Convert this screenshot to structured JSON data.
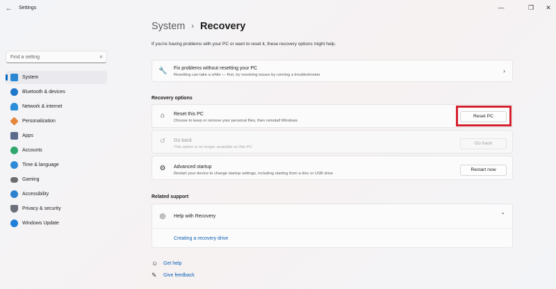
{
  "window": {
    "title": "Settings"
  },
  "search": {
    "placeholder": "Find a setting"
  },
  "sidebar": {
    "items": [
      {
        "label": "System",
        "icon": "monitor-icon",
        "color": "#2b87d1",
        "active": true
      },
      {
        "label": "Bluetooth & devices",
        "icon": "bluetooth-icon",
        "color": "#1e77c9"
      },
      {
        "label": "Network & internet",
        "icon": "wifi-icon",
        "color": "#2a8fd8"
      },
      {
        "label": "Personalization",
        "icon": "brush-icon",
        "color": "#e3863b"
      },
      {
        "label": "Apps",
        "icon": "apps-icon",
        "color": "#5b6b8c"
      },
      {
        "label": "Accounts",
        "icon": "person-icon",
        "color": "#2fa76e"
      },
      {
        "label": "Time & language",
        "icon": "globe-clock-icon",
        "color": "#2e8ad6"
      },
      {
        "label": "Gaming",
        "icon": "gamepad-icon",
        "color": "#6c6c6c"
      },
      {
        "label": "Accessibility",
        "icon": "accessibility-icon",
        "color": "#2d7fd0"
      },
      {
        "label": "Privacy & security",
        "icon": "shield-icon",
        "color": "#6b6f7a"
      },
      {
        "label": "Windows Update",
        "icon": "update-icon",
        "color": "#1f7fd8"
      }
    ]
  },
  "breadcrumb": {
    "parent": "System",
    "separator": "›",
    "current": "Recovery"
  },
  "description": "If you're having problems with your PC or want to reset it, these recovery options might help.",
  "fix_card": {
    "title": "Fix problems without resetting your PC",
    "subtitle": "Resetting can take a while — first, try resolving issues by running a troubleshooter"
  },
  "recovery_options": {
    "heading": "Recovery options",
    "reset": {
      "title": "Reset this PC",
      "subtitle": "Choose to keep or remove your personal files, then reinstall Windows",
      "button": "Reset PC"
    },
    "goback": {
      "title": "Go back",
      "subtitle": "This option is no longer available on this PC",
      "button": "Go back"
    },
    "advanced": {
      "title": "Advanced startup",
      "subtitle": "Restart your device to change startup settings, including starting from a disc or USB drive",
      "button": "Restart now"
    }
  },
  "related_support": {
    "heading": "Related support",
    "help": {
      "title": "Help with Recovery",
      "link": "Creating a recovery drive"
    }
  },
  "footer": {
    "get_help": "Get help",
    "give_feedback": "Give feedback"
  },
  "colors": {
    "accent": "#0067c0",
    "highlight": "#d41f2c",
    "link": "#0a5fb4"
  }
}
